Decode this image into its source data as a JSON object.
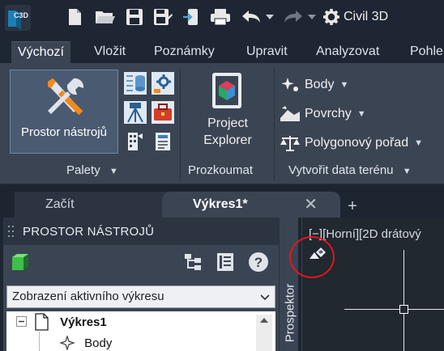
{
  "app": {
    "logo_text": "C3D"
  },
  "quick_access": {
    "workspace_label": "Civil 3D",
    "icons": [
      "new-file-icon",
      "open-folder-icon",
      "save-icon",
      "save-as-icon",
      "export-icon",
      "print-icon",
      "undo-icon",
      "redo-icon",
      "gear-icon"
    ]
  },
  "ribbon_tabs": [
    {
      "label": "Výchozí",
      "active": true
    },
    {
      "label": "Vložit"
    },
    {
      "label": "Poznámky"
    },
    {
      "label": "Upravit"
    },
    {
      "label": "Analyzovat"
    },
    {
      "label": "Pohle"
    }
  ],
  "ribbon": {
    "palette_panel": {
      "big_button_label": "Prostor nástrojů",
      "title": "Palety"
    },
    "explore_panel": {
      "button_line1": "Project",
      "button_line2": "Explorer",
      "title": "Prozkoumat"
    },
    "terrain_panel": {
      "items": [
        {
          "label": "Body"
        },
        {
          "label": "Povrchy"
        },
        {
          "label": "Polygonový pořad"
        }
      ],
      "title": "Vytvořit data terénu"
    }
  },
  "doc_tabs": {
    "start": "Začít",
    "drawing": "Výkres1*",
    "close_symbol": "✕",
    "add_symbol": "+"
  },
  "tool_palette": {
    "title": "PROSTOR NÁSTROJŮ",
    "view_select": "Zobrazení aktivního výkresu",
    "tree": {
      "root_collapse": "−",
      "root": "Výkres1",
      "child": "Body"
    },
    "side_tab": "Prospektor"
  },
  "viewport": {
    "label": "[−][Horní][2D drátový"
  },
  "colors": {
    "annotation_circle": "#e3161b",
    "ribbon_bg": "#3b4453",
    "accent_blue": "#6a87a8"
  }
}
